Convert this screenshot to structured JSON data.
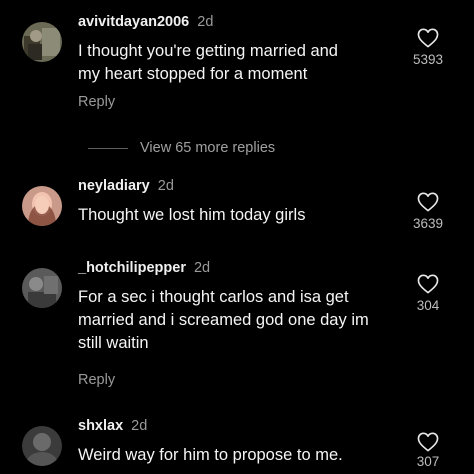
{
  "comments": [
    {
      "username": "avivitdayan2006",
      "time": "2d",
      "lines": [
        "I thought you're getting married and",
        "my heart stopped for a moment"
      ],
      "likes": "5393",
      "reply_label": "Reply",
      "avatar_icon": "profile-photo"
    },
    {
      "username": "neyladiary",
      "time": "2d",
      "lines": [
        "Thought we lost him today girls"
      ],
      "likes": "3639",
      "avatar_icon": "profile-photo"
    },
    {
      "username": "_hotchilipepper",
      "time": "2d",
      "lines": [
        "For a sec i thought carlos and isa get",
        "married and i screamed god one day im",
        "still waitin"
      ],
      "likes": "304",
      "reply_label": "Reply",
      "avatar_icon": "profile-photo"
    },
    {
      "username": "shxlax",
      "time": "2d",
      "lines": [
        "Weird way for him to propose to me."
      ],
      "likes": "307",
      "avatar_icon": "profile-photo"
    }
  ],
  "view_more": {
    "label": "View 65 more replies"
  },
  "icons": {
    "like": "heart-outline-icon"
  },
  "colors": {
    "background": "#000000",
    "primary_text": "#f5f5f5",
    "secondary_text": "#9a9a9a"
  }
}
